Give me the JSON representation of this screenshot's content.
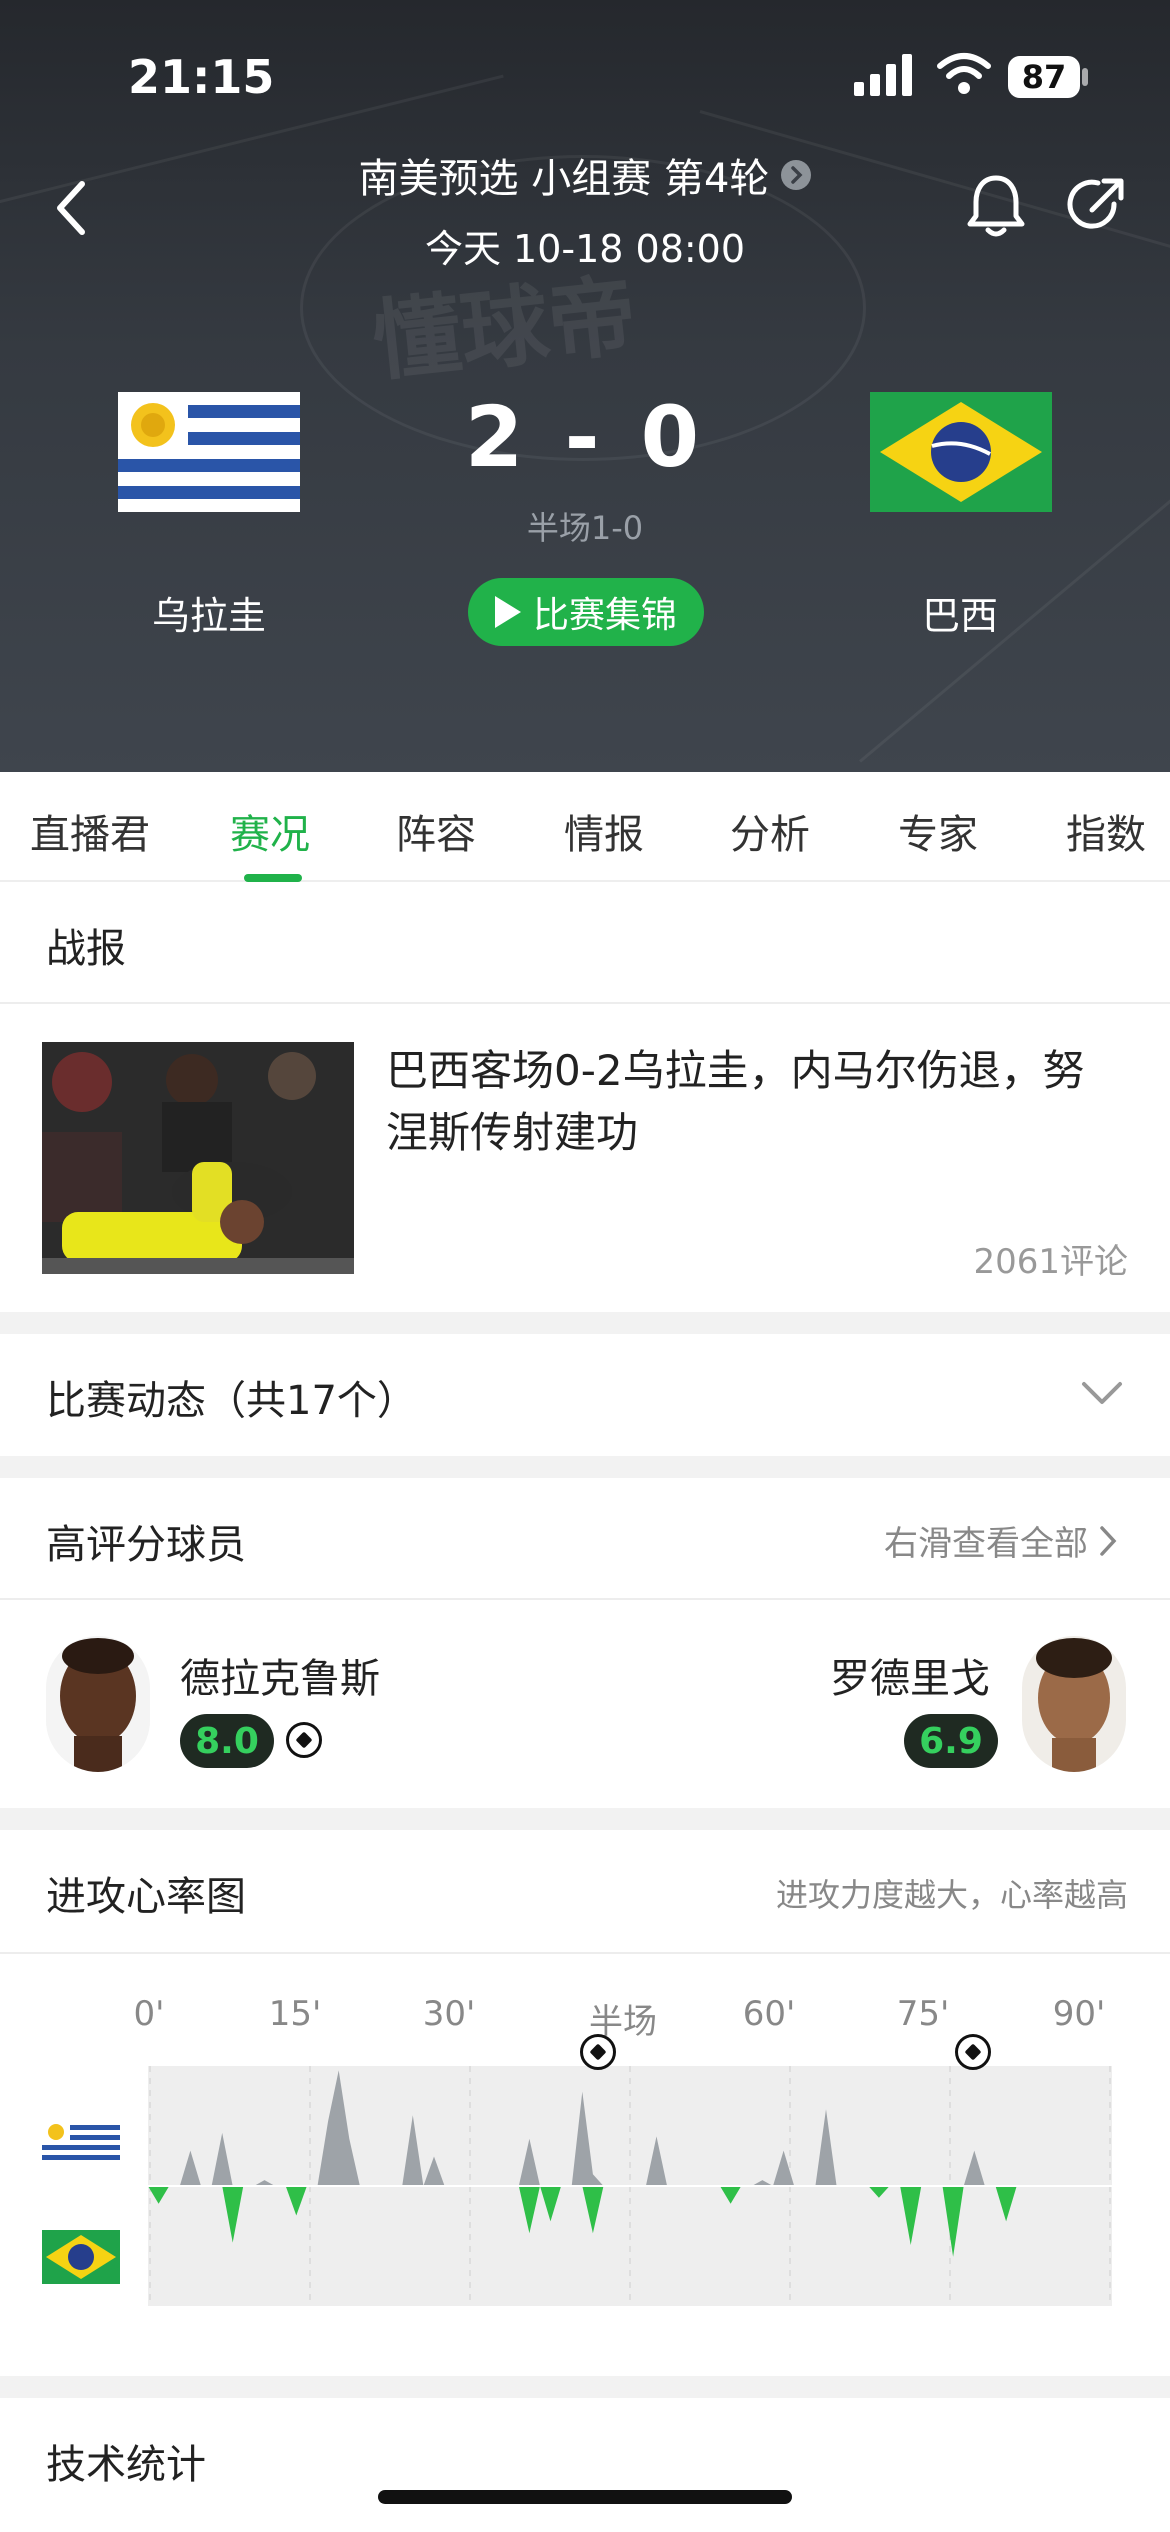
{
  "status_bar": {
    "time": "21:15",
    "battery": "87"
  },
  "header": {
    "competition": "南美预选 小组赛 第4轮",
    "datetime": "今天 10-18 08:00",
    "score": "2 - 0",
    "halftime": "半场1-0",
    "home_team": "乌拉圭",
    "away_team": "巴西",
    "highlights_label": "比赛集锦",
    "watermark": "懂球帝"
  },
  "tabs": [
    {
      "label": "直播君"
    },
    {
      "label": "赛况",
      "active": true
    },
    {
      "label": "阵容"
    },
    {
      "label": "情报"
    },
    {
      "label": "分析"
    },
    {
      "label": "专家"
    },
    {
      "label": "指数"
    }
  ],
  "report": {
    "title": "战报",
    "news_title": "巴西客场0-2乌拉圭，内马尔伤退，努涅斯传射建功",
    "comments": "2061评论"
  },
  "events": {
    "title": "比赛动态（共17个）"
  },
  "top_players": {
    "title": "高评分球员",
    "see_all": "右滑查看全部",
    "home": {
      "name": "德拉克鲁斯",
      "rating": "8.0"
    },
    "away": {
      "name": "罗德里戈",
      "rating": "6.9"
    }
  },
  "heart_rate": {
    "title": "进攻心率图",
    "hint": "进攻力度越大，心率越高",
    "ticks": [
      "0'",
      "15'",
      "30'",
      "半场",
      "60'",
      "75'",
      "90'"
    ],
    "goal_minutes": [
      42,
      77
    ]
  },
  "tech_stats": {
    "title": "技术统计"
  },
  "colors": {
    "accent_green": "#20b24a",
    "home_wave": "#9ea3a8",
    "away_wave": "#2fbf48"
  },
  "chart_data": {
    "type": "area",
    "x": [
      1,
      2,
      3,
      4,
      5,
      6,
      7,
      8,
      9,
      10,
      11,
      12,
      13,
      14,
      15,
      16,
      17,
      18,
      19,
      20,
      21,
      22,
      23,
      24,
      25,
      26,
      27,
      28,
      29,
      30,
      31,
      32,
      33,
      34,
      35,
      36,
      37,
      38,
      39,
      40,
      41,
      42,
      43,
      44,
      45,
      46,
      47,
      48,
      49,
      50,
      51,
      52,
      53,
      54,
      55,
      56,
      57,
      58,
      59,
      60,
      61,
      62,
      63,
      64,
      65,
      66,
      67,
      68,
      69,
      70,
      71,
      72,
      73,
      74,
      75,
      76,
      77,
      78,
      79,
      80,
      81,
      82,
      83,
      84,
      85,
      86,
      87,
      88,
      89,
      90,
      91,
      92
    ],
    "series": [
      {
        "values": [
          0,
          0,
          0,
          0,
          30,
          0,
          0,
          45,
          0,
          0,
          0,
          5,
          0,
          0,
          0,
          0,
          0,
          55,
          98,
          40,
          0,
          0,
          0,
          0,
          0,
          60,
          0,
          25,
          0,
          0,
          0,
          0,
          0,
          0,
          0,
          0,
          40,
          0,
          0,
          0,
          0,
          80,
          10,
          0,
          0,
          0,
          0,
          0,
          42,
          0,
          0,
          0,
          0,
          0,
          0,
          0,
          0,
          0,
          5,
          0,
          30,
          0,
          0,
          0,
          65,
          0,
          0,
          0,
          0,
          0,
          0,
          0,
          0,
          0,
          0,
          0,
          0,
          0,
          30,
          0,
          0,
          0,
          0,
          0,
          0,
          0,
          0,
          0,
          0,
          0,
          0,
          0
        ]
      },
      {
        "values": [
          0,
          15,
          0,
          0,
          0,
          0,
          0,
          0,
          48,
          0,
          0,
          0,
          0,
          0,
          25,
          0,
          0,
          0,
          0,
          0,
          0,
          0,
          0,
          0,
          0,
          0,
          0,
          0,
          0,
          0,
          0,
          0,
          0,
          0,
          0,
          0,
          40,
          0,
          30,
          0,
          0,
          0,
          40,
          0,
          0,
          0,
          0,
          0,
          0,
          0,
          0,
          0,
          0,
          0,
          0,
          15,
          0,
          0,
          0,
          0,
          0,
          0,
          0,
          0,
          0,
          0,
          0,
          0,
          0,
          10,
          0,
          0,
          50,
          0,
          0,
          0,
          60,
          0,
          0,
          0,
          0,
          30,
          0,
          0,
          0,
          0,
          0,
          0,
          0,
          0,
          0,
          0
        ]
      }
    ]
  }
}
